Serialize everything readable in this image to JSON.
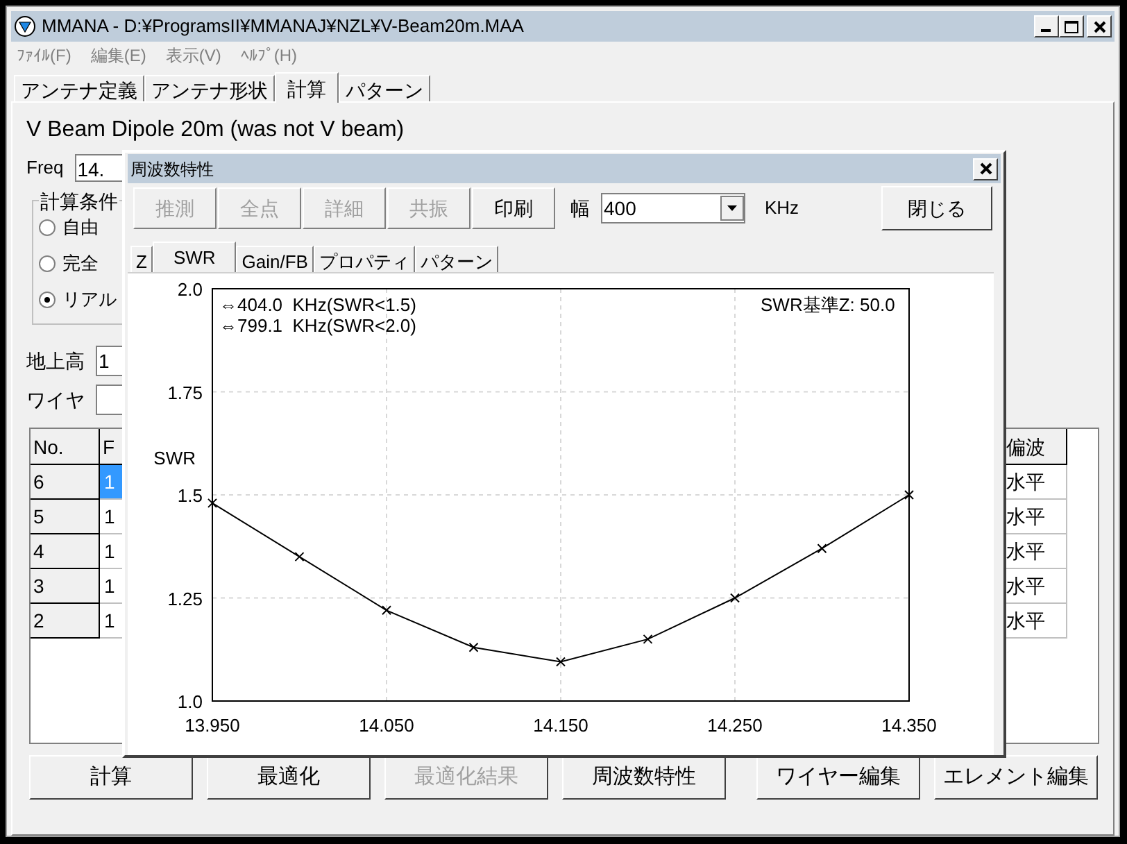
{
  "window": {
    "title": "MMANA - D:¥ProgramsII¥MMANAJ¥NZL¥V-Beam20m.MAA"
  },
  "menu": [
    "ﾌｧｲﾙ(F)",
    "編集(E)",
    "表示(V)",
    "ﾍﾙﾌﾟ(H)"
  ],
  "tabs": [
    {
      "label": "アンテナ定義",
      "selected": false
    },
    {
      "label": "アンテナ形状",
      "selected": false
    },
    {
      "label": "計算",
      "selected": true
    },
    {
      "label": "パターン",
      "selected": false
    }
  ],
  "antenna_name": "V Beam Dipole  20m (was not V beam)",
  "freq": {
    "label": "Freq",
    "value": "14."
  },
  "calc_conditions": {
    "title": "計算条件",
    "options": [
      {
        "label": "自由",
        "selected": false
      },
      {
        "label": "完全",
        "selected": false
      },
      {
        "label": "リアル",
        "selected": true
      }
    ]
  },
  "ground_height": {
    "label": "地上高",
    "value": "1"
  },
  "wire": {
    "label": "ワイヤ"
  },
  "table": {
    "columns": [
      "No.",
      "F",
      "偏波"
    ],
    "rows": [
      {
        "no": "6",
        "column_2": "1",
        "polarization": "水平",
        "selected": true
      },
      {
        "no": "5",
        "column_2": "1",
        "polarization": "水平",
        "selected": false
      },
      {
        "no": "4",
        "column_2": "1",
        "polarization": "水平",
        "selected": false
      },
      {
        "no": "3",
        "column_2": "1",
        "polarization": "水平",
        "selected": false
      },
      {
        "no": "2",
        "column_2": "1",
        "polarization": "水平",
        "selected": false
      }
    ]
  },
  "bottom_buttons": [
    {
      "label": "計算",
      "disabled": false
    },
    {
      "label": "最適化",
      "disabled": false
    },
    {
      "label": "最適化結果",
      "disabled": true
    },
    {
      "label": "周波数特性",
      "disabled": false
    },
    {
      "label": "ワイヤー編集",
      "disabled": false
    },
    {
      "label": "エレメント編集",
      "disabled": false
    }
  ],
  "dialog": {
    "title": "周波数特性",
    "buttons": [
      {
        "label": "推測",
        "disabled": true
      },
      {
        "label": "全点",
        "disabled": true
      },
      {
        "label": "詳細",
        "disabled": true
      },
      {
        "label": "共振",
        "disabled": true
      },
      {
        "label": "印刷",
        "disabled": false
      }
    ],
    "width": {
      "label": "幅",
      "value": "400",
      "unit": "KHz"
    },
    "close_button": "閉じる",
    "tabs": [
      {
        "label": "Z",
        "selected": false
      },
      {
        "label": "SWR",
        "selected": true
      },
      {
        "label": "Gain/FB",
        "selected": false
      },
      {
        "label": "プロパティ",
        "selected": false
      },
      {
        "label": "パターン",
        "selected": false
      }
    ],
    "bandwidth_notes": [
      "⇔404.0  KHz(SWR<1.5)",
      "⇔799.1  KHz(SWR<2.0)"
    ],
    "reference_impedance": "SWR基準Z: 50.0",
    "chart_data": {
      "type": "line",
      "ylabel": "SWR",
      "x": [
        13.95,
        14.0,
        14.05,
        14.1,
        14.15,
        14.2,
        14.25,
        14.3,
        14.35
      ],
      "grid": true,
      "series": [
        {
          "color": "#000000",
          "marker": "x",
          "values": [
            1.48,
            1.35,
            1.22,
            1.13,
            1.095,
            1.15,
            1.25,
            1.37,
            1.5
          ]
        }
      ],
      "xlim": [
        13.95,
        14.35
      ],
      "ylim": [
        1.0,
        2.0
      ],
      "xticks": [
        {
          "value": 13.95,
          "label": "13.950"
        },
        {
          "value": 14.05,
          "label": "14.050"
        },
        {
          "value": 14.15,
          "label": "14.150"
        },
        {
          "value": 14.25,
          "label": "14.250"
        },
        {
          "value": 14.35,
          "label": "14.350"
        }
      ],
      "yticks": [
        {
          "value": 1.0,
          "label": "1.0"
        },
        {
          "value": 1.25,
          "label": "1.25"
        },
        {
          "value": 1.5,
          "label": "1.5"
        },
        {
          "value": 1.75,
          "label": "1.75"
        },
        {
          "value": 2.0,
          "label": "2.0"
        }
      ]
    }
  }
}
